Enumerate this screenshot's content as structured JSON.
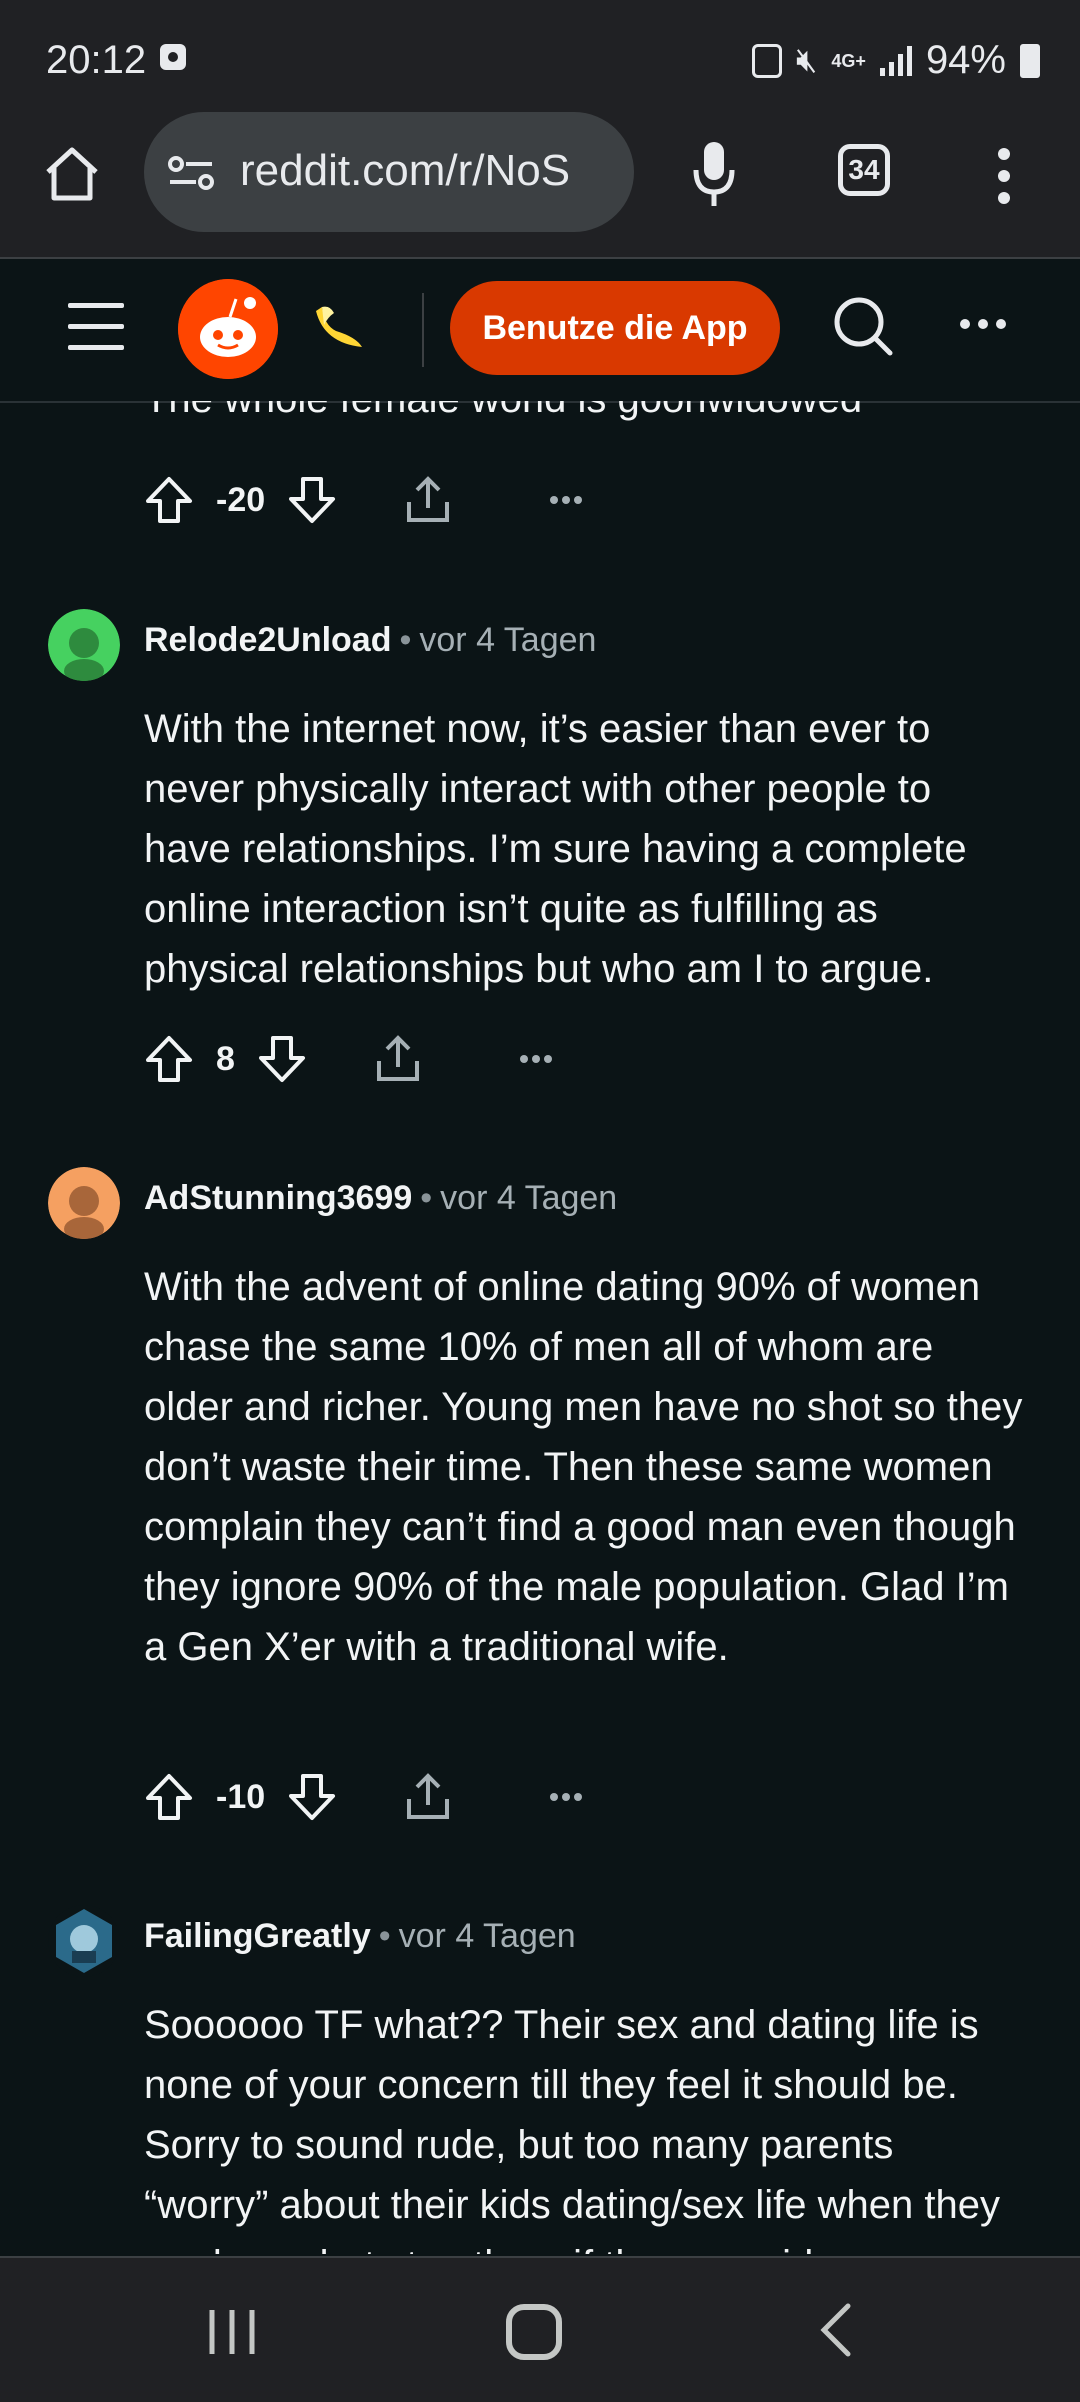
{
  "status_bar": {
    "time": "20:12",
    "network": "4G+",
    "battery": "94%"
  },
  "browser": {
    "url": "reddit.com/r/NoS",
    "tab_count": "34"
  },
  "reddit_header": {
    "app_button": "Benutze die App"
  },
  "feed": {
    "cut_text": "The whole female world is goonwidowed",
    "first_actions": {
      "score": "-20"
    },
    "comments": [
      {
        "author": "Relode2Unload",
        "time": "vor 4 Tagen",
        "avatar_color": "#46d160",
        "body": "With the internet now, it’s easier than ever to never physically interact with other people to have relationships. I’m sure having a complete online interaction isn’t quite as fulfilling as physical relationships but who am I to argue.",
        "score": "8"
      },
      {
        "author": "AdStunning3699",
        "time": "vor 4 Tagen",
        "avatar_color": "#f5a061",
        "body": "With the advent of online dating 90% of women chase the same 10% of men all of whom are older and richer. Young men have no shot so they don’t waste their time. Then these same women complain they can’t find a good man even though they ignore 90% of the male population. Glad I’m a Gen X’er with a traditional wife.",
        "score": "-10"
      },
      {
        "author": "FailingGreatly",
        "time": "vor 4 Tagen",
        "avatar_color": "#2b6a8a",
        "body": "Soooooo TF what?? Their sex and dating life is none of your concern till they feel it should be. Sorry to sound rude, but too many parents “worry” about their kids dating/sex life when they are boys, but stop them if they are girls"
      }
    ]
  },
  "separator": "•"
}
